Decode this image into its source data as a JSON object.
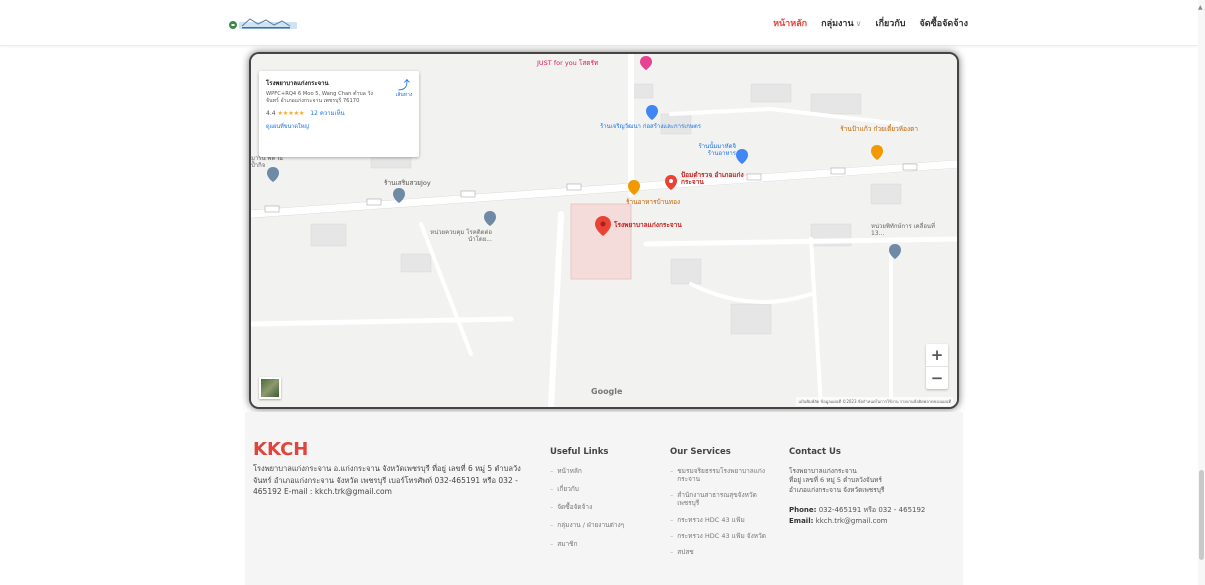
{
  "nav": {
    "logo": "logo",
    "items": [
      {
        "label": "หน้าหลัก",
        "active": true
      },
      {
        "label": "กลุ่มงาน",
        "dropdown": true
      },
      {
        "label": "เกี่ยวกับ"
      },
      {
        "label": "จัดซื้อจัดจ้าง"
      }
    ],
    "active_color": "#e0443e"
  },
  "map": {
    "place_name": "โรงพยาบาลแก่งกระจาน",
    "address": "WPFC+RQ4 6 Moo 5, Wang Chan ตำบล วังจันทร์ อำเภอแก่งกระจาน เพชรบุรี 76170",
    "rating": "4.4",
    "stars": "★★★★★",
    "reviews": "12 ความเห็น",
    "larger_map": "ดูแผนที่ขนาดใหญ่",
    "directions": "เส้นทาง",
    "zoom_in": "+",
    "zoom_out": "−",
    "google": "Google",
    "attribution": "แป้นพิมพ์ลัด   ข้อมูลแผนที่ ©2023   ข้อกำหนดในการใช้งาน   รายงานข้อผิดพลาดของแผนที่",
    "labels": {
      "just_for_you": "JUST for you โสตรัท",
      "hospital": "โรงพยาบาลแก่งกระจาน",
      "police": "ป้อมตำรวจ อำเภอแก่งกระจาน",
      "restaurant": "ร้านอาหารบ้านทอง",
      "joy": "ร้านเสริมสวยJoy",
      "shop_right": "ร้านป้าแก้ว ก๋วยเตี๋ยวห้องตา",
      "shop_center": "ร้านเจริญวัฒนา ก่อสร้างและการเกษตร",
      "shop_mid": "ร้านนั้มมาหัดจิ ร้านอาหาร",
      "unit_left": "หน่วยควบคุม โรคติดต่อนำโดย...",
      "unit_right": "หน่วยพิทักษ์การ เคลื่อนที่ 13...",
      "top_left": "มาริน พิต ณ ป้ำกิจ",
      "road": "เลียบ"
    }
  },
  "footer": {
    "brand": "KKCH",
    "about": "โรงพยาบาลแก่งกระจาน อ.แก่งกระจาน จังหวัดเพชรบุรี ที่อยู่ เลขที่ 6 หมู่ 5 ตำบลวังจันทร์ อำเภอแก่งกระจาน จังหวัด เพชรบุรี เบอร์โทรศัพท์ 032-465191 หรือ 032 - 465192 E-mail : kkch.trk@gmail.com",
    "useful_links": {
      "title": "Useful Links",
      "items": [
        "หน้าหลัก",
        "เกี่ยวกับ",
        "จัดซื้อจัดจ้าง",
        "กลุ่มงาน / ฝ่ายงานต่างๆ",
        "สมาชิก"
      ]
    },
    "services": {
      "title": "Our Services",
      "items": [
        "ชมรมจริยธรรมโรงพยาบาลแก่งกระจาน",
        "สำนักงานสาธารณสุขจังหวัดเพชรบุรี",
        "กระทรวง HDC 43 แฟ้ม",
        "กระทรวง HDC 43 แฟ้ม จังหวัด",
        "สปสช"
      ]
    },
    "contact": {
      "title": "Contact Us",
      "line1": "โรงพยาบาลแก่งกระจาน",
      "line2": "ที่อยู่ เลขที่ 6 หมู่ 5 ตำบลวังจันทร์",
      "line3": "อำเภอแก่งกระจาน จังหวัดเพชรบุรี",
      "phone_label": "Phone:",
      "phone": "032-465191 หรือ 032 - 465192",
      "email_label": "Email:",
      "email": "kkch.trk@gmail.com"
    }
  }
}
